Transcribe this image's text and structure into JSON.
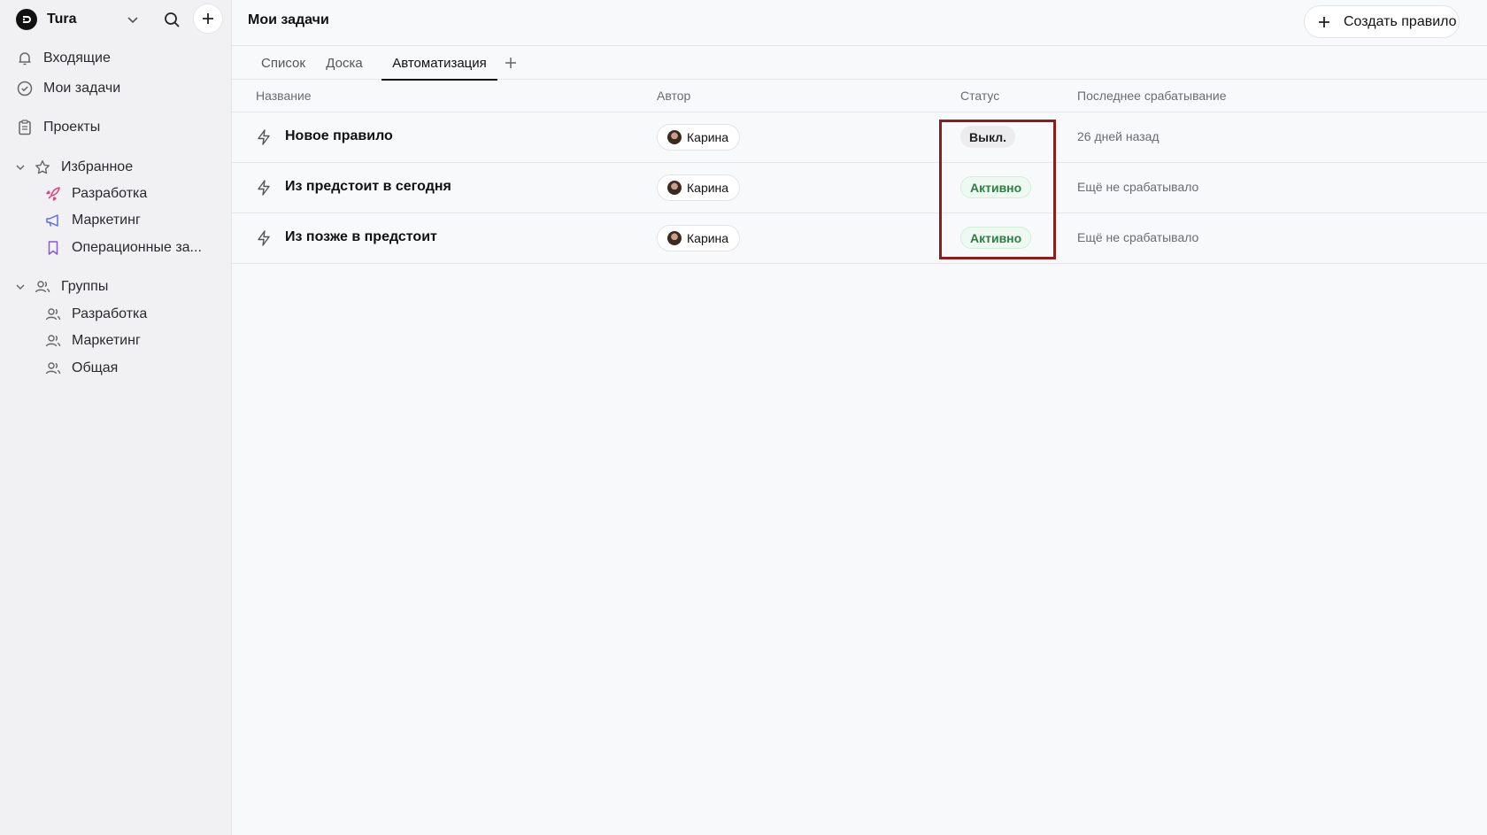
{
  "workspace": {
    "name": "Tura"
  },
  "sidebar": {
    "nav": [
      {
        "label": "Входящие",
        "icon": "bell-icon"
      },
      {
        "label": "Мои задачи",
        "icon": "check-circle-icon"
      },
      {
        "label": "Проекты",
        "icon": "clipboard-icon"
      }
    ],
    "favorites": {
      "label": "Избранное",
      "items": [
        {
          "label": "Разработка",
          "icon": "rocket-icon",
          "color": "#e0407a"
        },
        {
          "label": "Маркетинг",
          "icon": "megaphone-icon",
          "color": "#5b6ee8"
        },
        {
          "label": "Операционные за...",
          "icon": "bookmark-icon",
          "color": "#8a55e8"
        }
      ]
    },
    "groups": {
      "label": "Группы",
      "items": [
        {
          "label": "Разработка",
          "icon": "users-icon"
        },
        {
          "label": "Маркетинг",
          "icon": "users-icon"
        },
        {
          "label": "Общая",
          "icon": "users-icon"
        }
      ]
    }
  },
  "header": {
    "title": "Мои задачи",
    "create_label": "Создать правило"
  },
  "tabs": [
    {
      "label": "Список",
      "active": false
    },
    {
      "label": "Доска",
      "active": false
    },
    {
      "label": "Автоматизация",
      "active": true
    }
  ],
  "table": {
    "columns": [
      "Название",
      "Автор",
      "Статус",
      "Последнее срабатывание"
    ],
    "rows": [
      {
        "name": "Новое правило",
        "author": "Карина",
        "status": "Выкл.",
        "status_kind": "off",
        "last": "26 дней назад"
      },
      {
        "name": "Из предстоит в сегодня",
        "author": "Карина",
        "status": "Активно",
        "status_kind": "on",
        "last": "Ещё не срабатывало"
      },
      {
        "name": "Из позже в предстоит",
        "author": "Карина",
        "status": "Активно",
        "status_kind": "on",
        "last": "Ещё не срабатывало"
      }
    ]
  },
  "colors": {
    "active_status": "#2f7d44",
    "highlight": "#8d1c1c",
    "accent_text": "#111111"
  }
}
